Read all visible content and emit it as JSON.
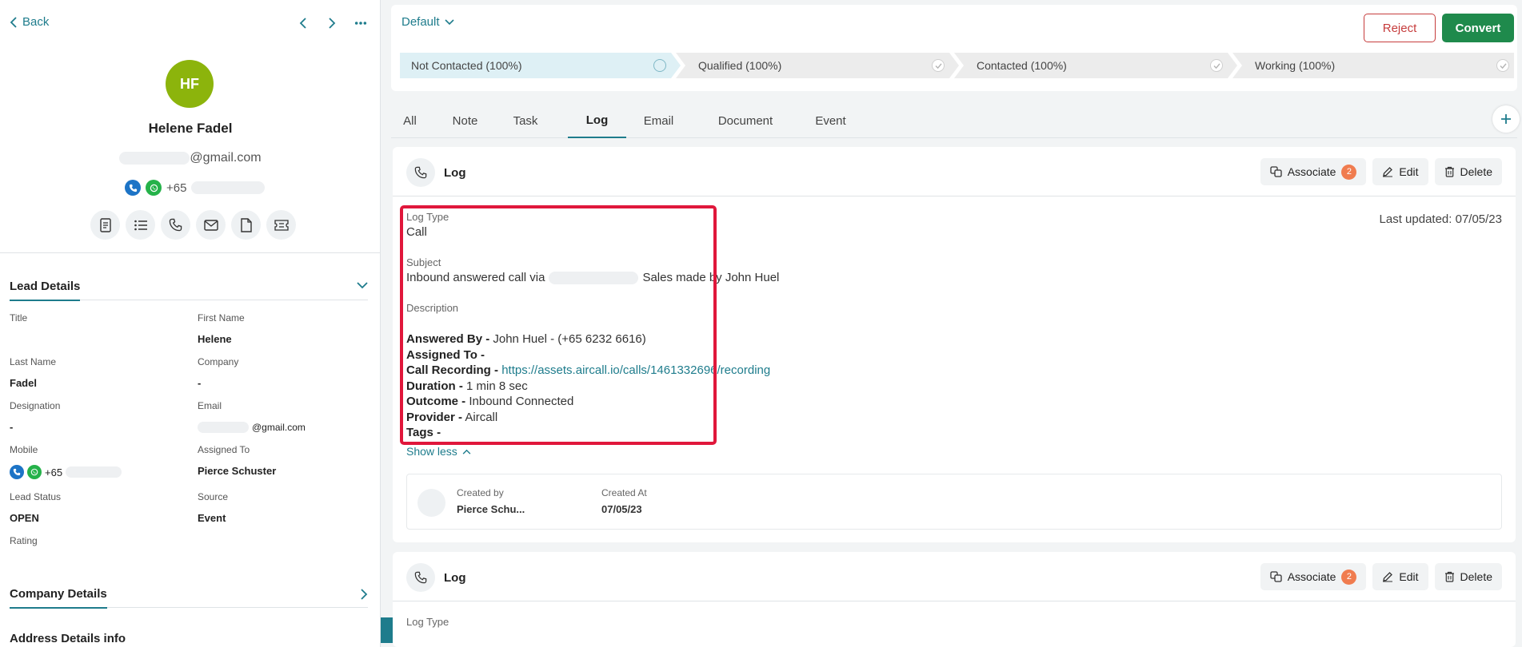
{
  "nav": {
    "back_label": "Back"
  },
  "lead": {
    "initials": "HF",
    "name": "Helene Fadel",
    "email_suffix": "@gmail.com",
    "phone_prefix": "+65"
  },
  "colors": {
    "accent": "#1e7c8c",
    "avatar": "#8cb40c",
    "reject": "#c63c3c",
    "convert": "#1f8a4c",
    "highlight": "#e0173b",
    "badge": "#f07c4f"
  },
  "quick_actions": [
    "notes-icon",
    "list-icon",
    "phone-icon",
    "mail-icon",
    "document-icon",
    "ticket-icon"
  ],
  "lead_details": {
    "title": "Lead Details",
    "fields": {
      "title_label": "Title",
      "first_name_label": "First Name",
      "first_name_value": "Helene",
      "last_name_label": "Last Name",
      "last_name_value": "Fadel",
      "company_label": "Company",
      "company_value": "-",
      "designation_label": "Designation",
      "designation_value": "-",
      "email_label": "Email",
      "email_value": "@gmail.com",
      "mobile_label": "Mobile",
      "mobile_value": "+65",
      "assigned_to_label": "Assigned To",
      "assigned_to_value": "Pierce Schuster",
      "lead_status_label": "Lead Status",
      "lead_status_value": "OPEN",
      "source_label": "Source",
      "source_value": "Event",
      "rating_label": "Rating"
    }
  },
  "company_details": {
    "title": "Company Details"
  },
  "address_details": {
    "title": "Address Details info"
  },
  "header": {
    "view_select": "Default",
    "reject_label": "Reject",
    "convert_label": "Convert",
    "stages": [
      {
        "label": "Not Contacted (100%)"
      },
      {
        "label": "Qualified (100%)"
      },
      {
        "label": "Contacted (100%)"
      },
      {
        "label": "Working (100%)"
      }
    ]
  },
  "tabs": [
    "All",
    "Note",
    "Task",
    "Log",
    "Email",
    "Document",
    "Event"
  ],
  "active_tab": "Log",
  "logs": [
    {
      "title": "Log",
      "associate_label": "Associate",
      "associate_count": "2",
      "edit_label": "Edit",
      "delete_label": "Delete",
      "log_type_label": "Log Type",
      "log_type_value": "Call",
      "subject_label": "Subject",
      "subject_prefix": "Inbound answered call via",
      "subject_suffix": "Sales made by John Huel",
      "description_label": "Description",
      "description": {
        "answered_by_label": "Answered By -",
        "answered_by_value": "John Huel  - (+65 6232 6616)",
        "assigned_to_label": "Assigned To -",
        "call_recording_label": "Call Recording -",
        "call_recording_value": "https://assets.aircall.io/calls/1461332696/recording",
        "duration_label": "Duration -",
        "duration_value": "1 min 8 sec",
        "outcome_label": "Outcome -",
        "outcome_value": "Inbound Connected",
        "provider_label": "Provider -",
        "provider_value": "Aircall",
        "tags_label": "Tags -"
      },
      "last_updated": "Last updated: 07/05/23",
      "show_less_label": "Show less",
      "created_by_label": "Created by",
      "created_by_value": "Pierce Schu...",
      "created_at_label": "Created At",
      "created_at_value": "07/05/23"
    },
    {
      "title": "Log",
      "associate_label": "Associate",
      "associate_count": "2",
      "edit_label": "Edit",
      "delete_label": "Delete",
      "log_type_label": "Log Type"
    }
  ]
}
